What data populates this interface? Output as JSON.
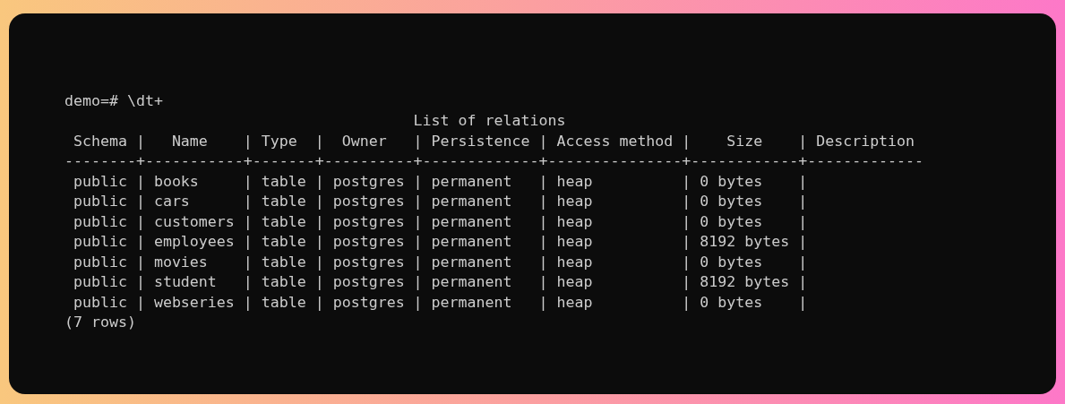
{
  "terminal": {
    "lines": [
      "demo=# \\dt+",
      "                                       List of relations",
      " Schema |   Name    | Type  |  Owner   | Persistence | Access method |    Size    | Description",
      "--------+-----------+-------+----------+-------------+---------------+------------+-------------",
      " public | books     | table | postgres | permanent   | heap          | 0 bytes    |",
      " public | cars      | table | postgres | permanent   | heap          | 0 bytes    |",
      " public | customers | table | postgres | permanent   | heap          | 0 bytes    |",
      " public | employees | table | postgres | permanent   | heap          | 8192 bytes |",
      " public | movies    | table | postgres | permanent   | heap          | 0 bytes    |",
      " public | student   | table | postgres | permanent   | heap          | 8192 bytes |",
      " public | webseries | table | postgres | permanent   | heap          | 0 bytes    |",
      "(7 rows)"
    ]
  }
}
